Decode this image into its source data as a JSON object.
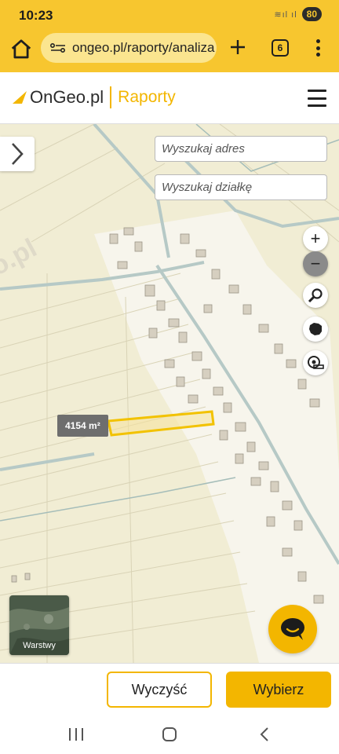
{
  "status_bar": {
    "time": "10:23",
    "battery": "80"
  },
  "browser": {
    "url": "ongeo.pl/raporty/analiza",
    "tab_count": "6"
  },
  "site": {
    "logo_text": "OnGeo.pl",
    "logo_sub": "Raporty"
  },
  "map": {
    "search_address_placeholder": "Wyszukaj adres",
    "search_parcel_placeholder": "Wyszukaj działkę",
    "zoom_in": "+",
    "zoom_out": "−",
    "area_label": "4154 m²",
    "layers_label": "Warstwy",
    "watermark": "o.pl"
  },
  "actions": {
    "clear_label": "Wyczyść",
    "select_label": "Wybierz"
  },
  "colors": {
    "accent": "#f7c62f",
    "brand": "#f3b600",
    "parcel_outline": "#f2c200"
  }
}
